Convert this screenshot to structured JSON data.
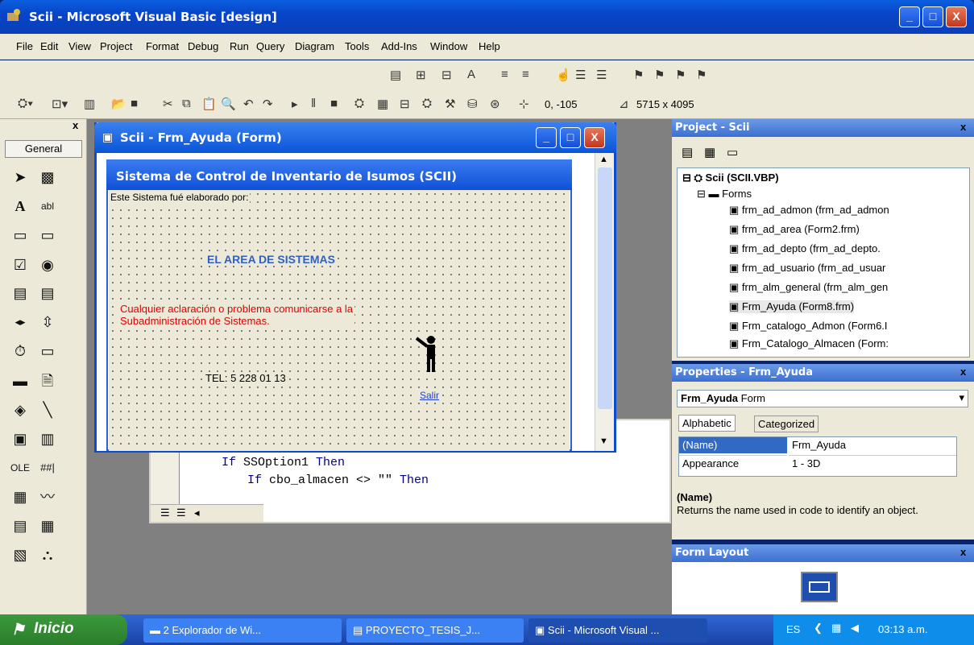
{
  "window": {
    "title": "Scii - Microsoft Visual Basic [design]",
    "min": "_",
    "max": "□",
    "close": "X"
  },
  "menu": [
    "File",
    "Edit",
    "View",
    "Project",
    "Format",
    "Debug",
    "Run",
    "Query",
    "Diagram",
    "Tools",
    "Add-Ins",
    "Window",
    "Help"
  ],
  "toolbar": {
    "position": "0, -105",
    "size": "5715 x 4095"
  },
  "toolbox": {
    "title": "General",
    "close": "x"
  },
  "form_window": {
    "title": "Scii - Frm_Ayuda (Form)"
  },
  "inner_form": {
    "title": "Sistema de Control de Inventario de Isumos (SCII)",
    "label_elaborado": "Este Sistema fué elaborado por:",
    "label_area": "EL AREA DE SISTEMAS",
    "label_aclaracion_1": "Cualquier aclaración o problema comunicarse a la",
    "label_aclaracion_2": "Subadministración de Sistemas.",
    "label_tel": "TEL: 5 228 01 13",
    "salir": "Salir"
  },
  "code": {
    "line1_kw": "If",
    "line1_txt": " SSOption1 ",
    "line1_kw2": "Then",
    "line2_kw": "If",
    "line2_txt": " cbo_almacen <> \"\" ",
    "line2_kw2": "Then"
  },
  "project": {
    "title": "Project - Scii",
    "root": "Scii (SCII.VBP)",
    "folder": "Forms",
    "items": [
      "frm_ad_admon (frm_ad_admon",
      "frm_ad_area (Form2.frm)",
      "frm_ad_depto (frm_ad_depto.",
      "frm_ad_usuario (frm_ad_usuar",
      "frm_alm_general (frm_alm_gen",
      "Frm_Ayuda (Form8.frm)",
      "Frm_catalogo_Admon (Form6.I",
      "Frm_Catalogo_Almacen (Form:"
    ]
  },
  "properties": {
    "title": "Properties - Frm_Ayuda",
    "object_name": "Frm_Ayuda",
    "object_type": "Form",
    "tab_alpha": "Alphabetic",
    "tab_cat": "Categorized",
    "rows": [
      {
        "k": "(Name)",
        "v": "Frm_Ayuda"
      },
      {
        "k": "Appearance",
        "v": "1 - 3D"
      }
    ],
    "desc_title": "(Name)",
    "desc_text": "Returns the name used in code to identify an object."
  },
  "form_layout": {
    "title": "Form Layout"
  },
  "taskbar": {
    "start": "Inicio",
    "tasks": [
      "2 Explorador de Wi...",
      "PROYECTO_TESIS_J...",
      "Scii - Microsoft Visual ..."
    ],
    "lang": "ES",
    "clock": "03:13 a.m."
  },
  "colors": {
    "xp_blue": "#0a5fe0",
    "label_blue": "#3060c0",
    "label_red": "#e00000"
  }
}
